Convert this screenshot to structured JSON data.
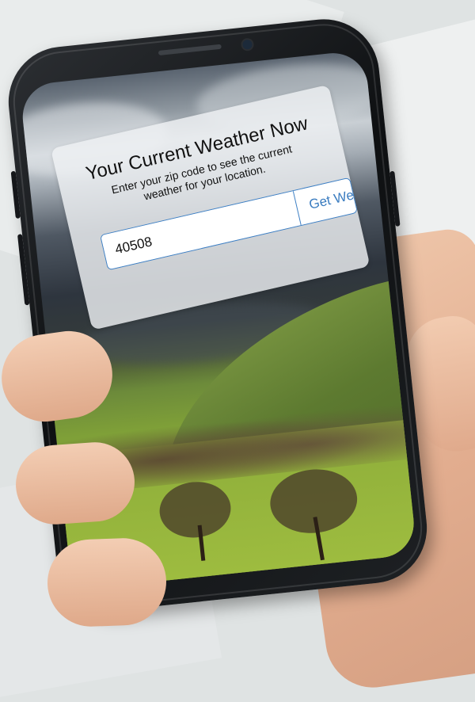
{
  "app": {
    "title": "Your Current Weather Now",
    "subtitle": "Enter your zip code to see the current weather for your location."
  },
  "form": {
    "zip_value": "40508",
    "zip_placeholder": "",
    "button_label": "Get Weather"
  },
  "colors": {
    "accent": "#3a7cc0",
    "panel_bg": "#eef0f3"
  }
}
